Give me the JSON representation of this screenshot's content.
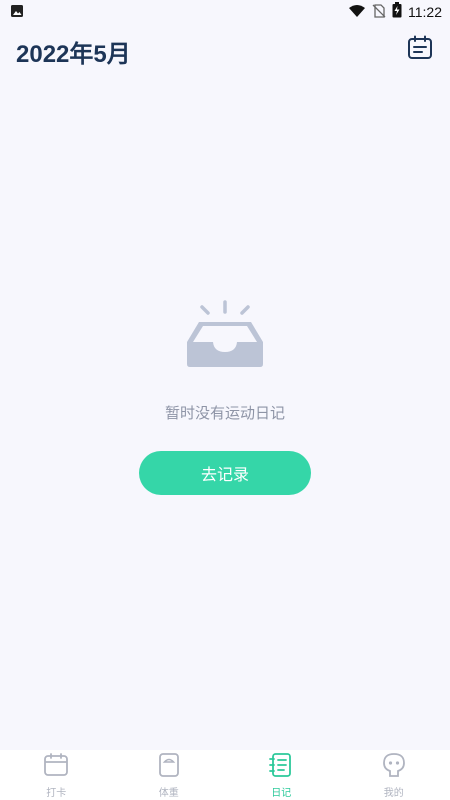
{
  "status_bar": {
    "time": "11:22"
  },
  "header": {
    "title": "2022年5月"
  },
  "empty_state": {
    "message": "暂时没有运动日记",
    "action_label": "去记录"
  },
  "tabs": [
    {
      "label": "打卡",
      "icon": "calendar-icon",
      "active": false
    },
    {
      "label": "体重",
      "icon": "scale-icon",
      "active": false
    },
    {
      "label": "日记",
      "icon": "notebook-icon",
      "active": true
    },
    {
      "label": "我的",
      "icon": "profile-icon",
      "active": false
    }
  ],
  "colors": {
    "accent": "#35d6a8",
    "title": "#1d3557",
    "inactive": "#b0b4c0",
    "background": "#f7f7fd"
  }
}
